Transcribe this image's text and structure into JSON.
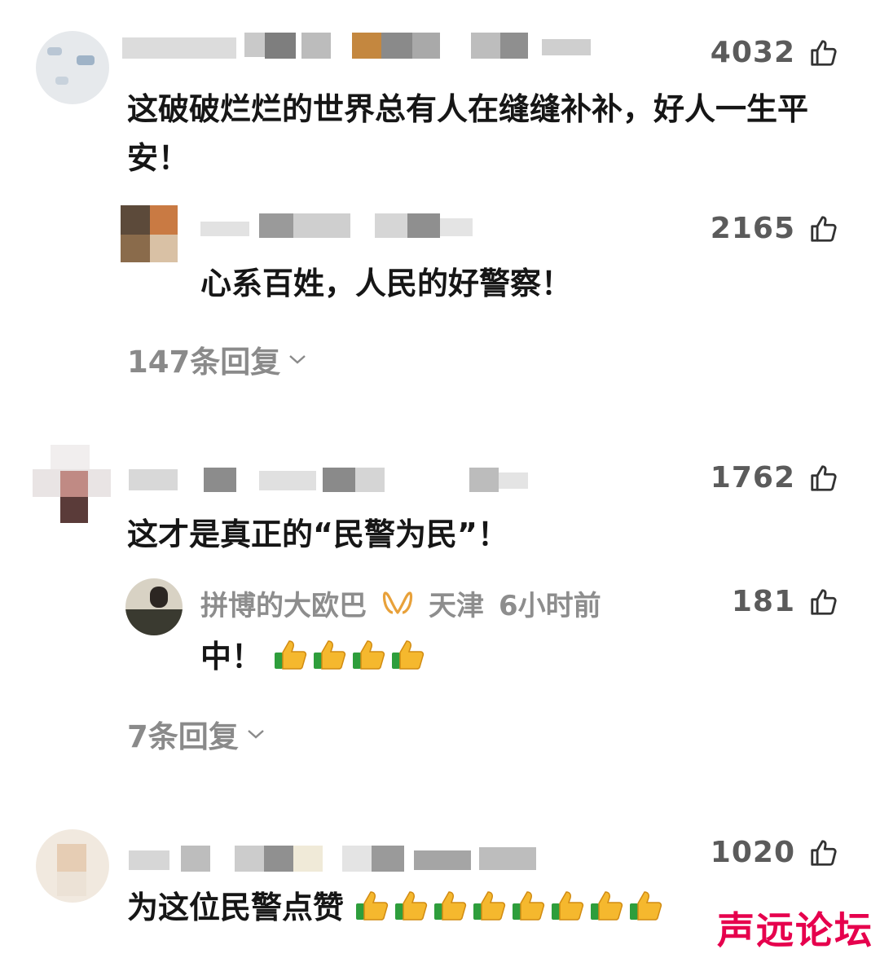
{
  "comments": [
    {
      "likes": "4032",
      "text": "这破破烂烂的世界总有人在缝缝补补，好人一生平安！",
      "reply": {
        "likes": "2165",
        "text": "心系百姓，人民的好警察！"
      },
      "reply_count": "147条回复"
    },
    {
      "likes": "1762",
      "text": "这才是真正的“民警为民”！",
      "reply": {
        "likes": "181",
        "username": "拼博的大欧巴",
        "location": "天津",
        "time": "6小时前",
        "text": "中！"
      },
      "reply_count": "7条回复"
    },
    {
      "likes": "1020",
      "text": "为这位民警点赞"
    }
  ],
  "icons": {
    "like": "thumbs-up-outline-icon",
    "vip": "vip-badge-icon",
    "expand": "chevron-down-icon",
    "emoji": "thumbs-up-emoji"
  },
  "colors": {
    "text": "#161616",
    "muted": "#8a8a8a",
    "like": "#5b5b5b",
    "watermark": "#e6004d",
    "vip": "#e8a13a"
  },
  "watermark": "声远论坛"
}
